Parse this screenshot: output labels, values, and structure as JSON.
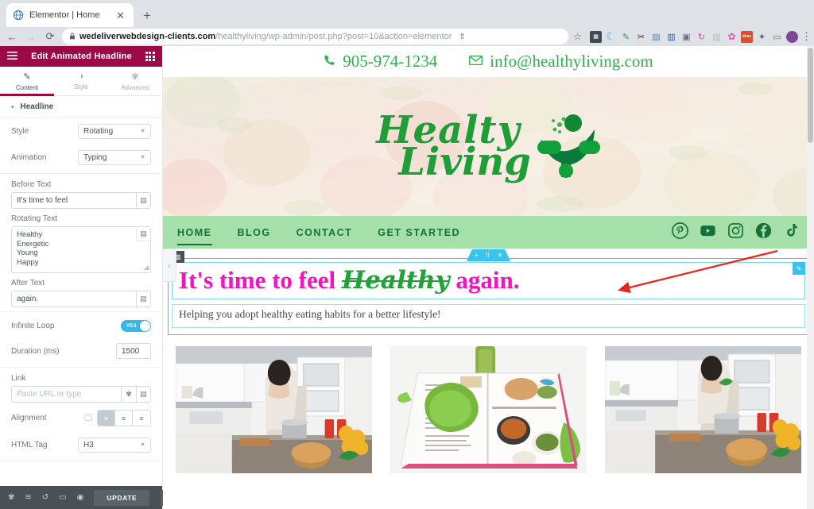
{
  "browser": {
    "tab": {
      "title": "Elementor | Home",
      "favicon_icon": "globe-icon",
      "close_icon": "✕"
    },
    "new_tab_label": "+",
    "nav": {
      "back": "←",
      "forward": "→",
      "reload": "⟳"
    },
    "url_bold": "wedeliverwebdesign-clients.com",
    "url_rest": "/healthyliving/wp-admin/post.php?post=10&action=elementor",
    "lock_icon": "lock-icon",
    "share_icon": "⇪",
    "bookmark_icon": "☆",
    "menu_icon": "⋮",
    "extensions": [
      {
        "name": "calendar-extension-icon",
        "color": "#3f4a55",
        "glyph": "▦"
      },
      {
        "name": "moon-extension-icon",
        "color": "#ffffff",
        "glyph": "☾"
      },
      {
        "name": "eyedropper-extension-icon",
        "color": "#ffffff",
        "glyph": "✎"
      },
      {
        "name": "ruler-extension-icon",
        "color": "#ffffff",
        "glyph": "⌁"
      },
      {
        "name": "document-extension-icon",
        "color": "#ffffff",
        "glyph": "▤"
      },
      {
        "name": "book-extension-icon",
        "color": "#ffffff",
        "glyph": "▥"
      },
      {
        "name": "camera-extension-icon",
        "color": "#ffffff",
        "glyph": "▣"
      },
      {
        "name": "refresh-extension-icon",
        "color": "#ffffff",
        "glyph": "↻"
      },
      {
        "name": "grey-extension-icon",
        "color": "#ffffff",
        "glyph": "▨"
      },
      {
        "name": "colorzilla-extension-icon",
        "color": "#ffffff",
        "glyph": "✿"
      },
      {
        "name": "desc-extension-icon",
        "color": "#ffffff",
        "glyph": "desc"
      },
      {
        "name": "puzzle-extensions-icon",
        "color": "#ffffff",
        "glyph": "🧩"
      },
      {
        "name": "sidepanel-icon",
        "color": "#ffffff",
        "glyph": "▭"
      },
      {
        "name": "profile-avatar",
        "color": "#7a4b9b",
        "glyph": "●"
      }
    ]
  },
  "panel": {
    "header": {
      "menu_icon": "hamburger-icon",
      "title": "Edit Animated Headline",
      "widgets_icon": "widgets-grid-icon"
    },
    "tabs": [
      {
        "label": "Content",
        "icon": "pencil-icon",
        "active": true
      },
      {
        "label": "Style",
        "icon": "contrast-icon",
        "active": false
      },
      {
        "label": "Advanced",
        "icon": "gear-icon",
        "active": false
      }
    ],
    "section": {
      "label": "Headline",
      "caret": "▾"
    },
    "controls": {
      "style_label": "Style",
      "style_value": "Rotating",
      "animation_label": "Animation",
      "animation_value": "Typing",
      "before_text_label": "Before Text",
      "before_text_value": "It's time to feel",
      "rotating_text_label": "Rotating Text",
      "rotating_text_value": "Healthy\nEnergetic\nYoung\nHappy",
      "after_text_label": "After Text",
      "after_text_value": "again.",
      "infinite_loop_label": "Infinite Loop",
      "infinite_loop_state": "YES",
      "duration_label": "Duration (ms)",
      "duration_value": "1500",
      "link_label": "Link",
      "link_placeholder": "Paste URL or type",
      "alignment_label": "Alignment",
      "alignment_device_icon": "desktop-icon",
      "alignment_options": [
        "align-left",
        "align-center",
        "align-right"
      ],
      "alignment_selected": 0,
      "html_tag_label": "HTML Tag",
      "html_tag_value": "H3",
      "dynamic_tag_icon": "database-icon",
      "link_settings_icon": "gear-icon"
    },
    "footer": {
      "icons": [
        "settings-icon",
        "navigator-icon",
        "history-icon",
        "responsive-icon",
        "preview-eye-icon"
      ],
      "update_label": "UPDATE",
      "update_caret": "▴"
    }
  },
  "site": {
    "topbar": {
      "phone_icon": "phone-icon",
      "phone": "905-974-1234",
      "email_icon": "envelope-icon",
      "email": "info@healthyliving.com"
    },
    "logo": {
      "line1": "Healty",
      "line2": "Living",
      "mark": "person-leaf-logo-icon"
    },
    "nav": [
      {
        "label": "HOME",
        "active": true
      },
      {
        "label": "BLOG",
        "active": false
      },
      {
        "label": "CONTACT",
        "active": false
      },
      {
        "label": "GET STARTED",
        "active": false
      }
    ],
    "socials": [
      "pinterest-icon",
      "youtube-icon",
      "instagram-icon",
      "facebook-icon",
      "tiktok-icon"
    ],
    "hero_headline": {
      "before": "It's time to feel ",
      "rotating": "Healthy",
      "after": " again."
    },
    "subheadline": "Helping you adopt healthy eating habits for a better lifestyle!",
    "colors": {
      "headline_pink": "#f711c0",
      "rotating_green": "#1fa237",
      "nav_green": "#a5e0a9",
      "nav_text_green": "#17703a",
      "elementor_blue": "#39c3f0",
      "elementor_maroon": "#9b0a46",
      "contact_green": "#2bb24c"
    },
    "cards": [
      {
        "name": "woman-cooking-kitchen-image"
      },
      {
        "name": "open-cookbook-with-lettuce-image"
      },
      {
        "name": "woman-cooking-kitchen-image-2"
      }
    ]
  },
  "editor_overlays": {
    "section_handle": {
      "add_icon": "+",
      "drag_icon": "⠿",
      "close_icon": "✕"
    },
    "widget_grip_icon": "columns-icon",
    "widget_edit_icon": "pencil-icon",
    "collapse_tab_icon": "‹",
    "annotation_arrow": "red-arrow-annotation"
  }
}
